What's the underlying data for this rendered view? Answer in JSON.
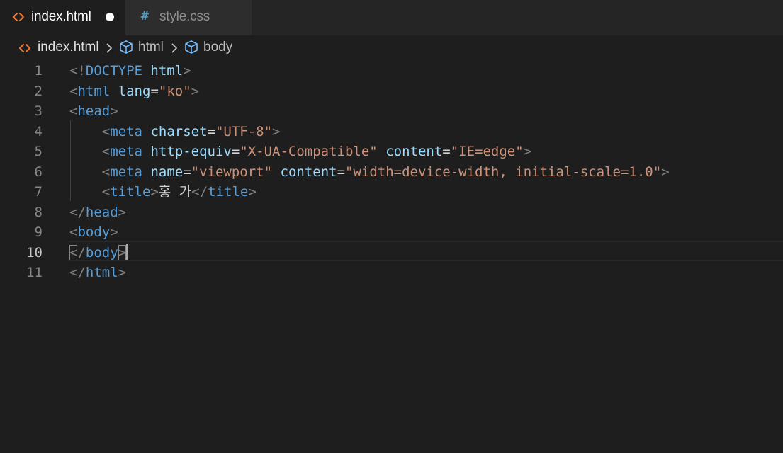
{
  "tabs": [
    {
      "label": "index.html",
      "icon": "html-file-icon",
      "dirty": true,
      "active": true
    },
    {
      "label": "style.css",
      "icon": "css-file-icon",
      "dirty": false,
      "active": false
    }
  ],
  "css_icon_glyph": "#",
  "breadcrumb": {
    "file": "index.html",
    "items": [
      "html",
      "body"
    ]
  },
  "editor": {
    "active_line": 10,
    "cursor": {
      "line": 10,
      "column": 8
    },
    "lines": [
      {
        "number": "1",
        "text": "<!DOCTYPE html>"
      },
      {
        "number": "2",
        "text": "<html lang=\"ko\">"
      },
      {
        "number": "3",
        "text": "<head>"
      },
      {
        "number": "4",
        "text": "    <meta charset=\"UTF-8\">"
      },
      {
        "number": "5",
        "text": "    <meta http-equiv=\"X-UA-Compatible\" content=\"IE=edge\">"
      },
      {
        "number": "6",
        "text": "    <meta name=\"viewport\" content=\"width=device-width, initial-scale=1.0\">"
      },
      {
        "number": "7",
        "text": "    <title>홍 가</title>"
      },
      {
        "number": "8",
        "text": "</head>"
      },
      {
        "number": "9",
        "text": "<body>"
      },
      {
        "number": "10",
        "text": "</body>"
      },
      {
        "number": "11",
        "text": "</html>"
      }
    ]
  },
  "colors": {
    "background": "#1e1e1e",
    "tab_bar": "#252526",
    "html_icon": "#e37933",
    "css_icon": "#519aba",
    "tag": "#569cd6",
    "attribute": "#9cdcfe",
    "string": "#ce9178",
    "bracket": "#808080"
  }
}
